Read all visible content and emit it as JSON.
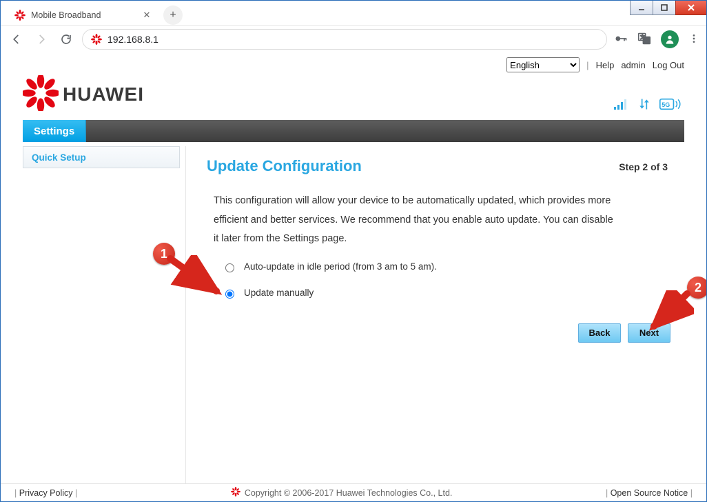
{
  "browser": {
    "tab_title": "Mobile Broadband",
    "url": "192.168.8.1"
  },
  "top": {
    "language": "English",
    "help": "Help",
    "user": "admin",
    "logout": "Log Out"
  },
  "brand": {
    "name": "HUAWEI"
  },
  "nav": {
    "settings": "Settings"
  },
  "sidebar": {
    "quick_setup": "Quick Setup"
  },
  "content": {
    "title": "Update Configuration",
    "step": "Step 2 of 3",
    "description": "This configuration will allow your device to be automatically updated, which provides more efficient and better services. We recommend that you enable auto update. You can disable it later from the Settings page.",
    "option_auto": "Auto-update in idle period (from 3 am to 5 am).",
    "option_manual": "Update manually",
    "selected": "manual",
    "back": "Back",
    "next": "Next"
  },
  "annotations": {
    "one": "1",
    "two": "2"
  },
  "footer": {
    "privacy": "Privacy Policy",
    "copyright": "Copyright © 2006-2017 Huawei Technologies Co., Ltd.",
    "oss": "Open Source Notice"
  }
}
